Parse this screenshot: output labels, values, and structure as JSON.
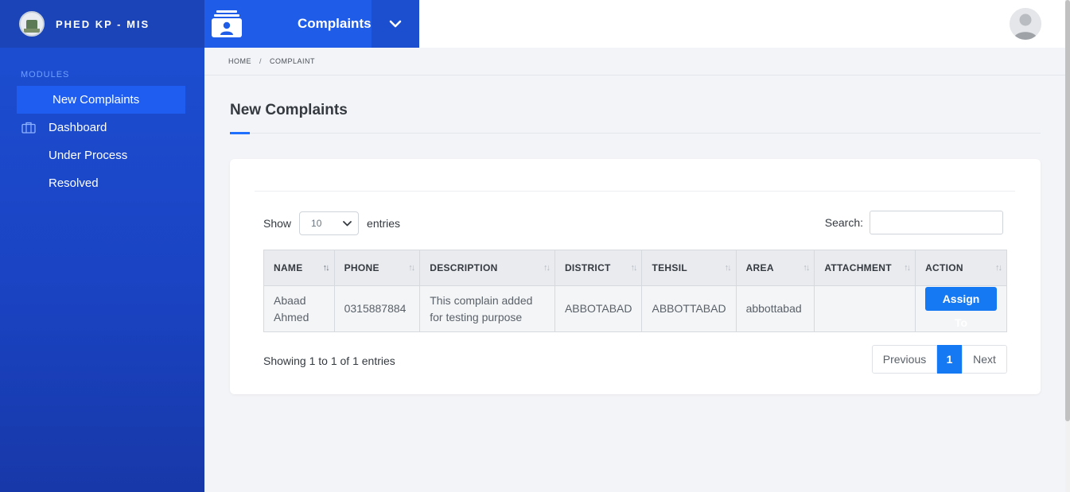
{
  "brand": {
    "title": "PHED KP - MIS"
  },
  "sidebar": {
    "section_label": "MODULES",
    "items": [
      {
        "label": "New Complaints",
        "active": true
      },
      {
        "label": "Dashboard",
        "icon": "briefcase-icon"
      },
      {
        "label": "Under Process"
      },
      {
        "label": "Resolved"
      }
    ]
  },
  "topbar": {
    "module_title": "Complaints"
  },
  "breadcrumb": {
    "home": "HOME",
    "separator": "/",
    "current": "COMPLAINT"
  },
  "page": {
    "title": "New Complaints"
  },
  "table_controls": {
    "show_label": "Show",
    "page_size": "10",
    "entries_label": "entries",
    "search_label": "Search:",
    "search_value": ""
  },
  "table": {
    "columns": [
      "NAME",
      "PHONE",
      "DESCRIPTION",
      "DISTRICT",
      "TEHSIL",
      "AREA",
      "ATTACHMENT",
      "ACTION"
    ],
    "rows": [
      {
        "name": "Abaad Ahmed",
        "phone": "0315887884",
        "description": "This complain added for testing purpose",
        "district": "ABBOTABAD",
        "tehsil": "ABBOTTABAD",
        "area": "abbottabad",
        "attachment": "",
        "action": "Assign To"
      }
    ]
  },
  "footer": {
    "info": "Showing 1 to 1 of 1 entries",
    "previous": "Previous",
    "current_page": "1",
    "next": "Next"
  },
  "colors": {
    "sidebar": "#1d4fd3",
    "accent": "#1479f3",
    "module_bar": "#1f5de8"
  }
}
